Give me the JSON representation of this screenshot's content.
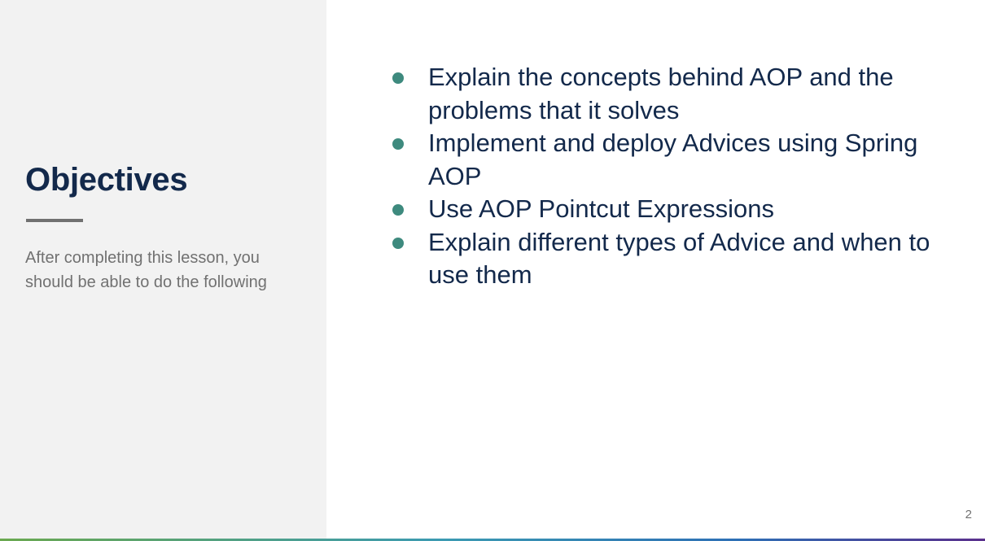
{
  "slide": {
    "title": "Objectives",
    "subtitle": "After completing this lesson, you should be able to do the following",
    "bullets": [
      "Explain the concepts behind AOP and the problems that it solves",
      "Implement and deploy Advices using Spring AOP",
      "Use AOP Pointcut Expressions",
      "Explain different types of Advice and when to use them"
    ],
    "page_number": "2"
  },
  "colors": {
    "title": "#13294b",
    "bullet_dot": "#3e8a7e",
    "panel_background": "#f2f2f2",
    "muted_text": "#717171"
  }
}
